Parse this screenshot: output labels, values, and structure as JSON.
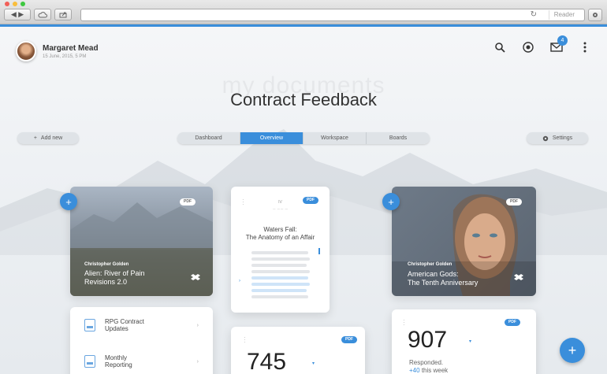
{
  "browser": {
    "reader_label": "Reader"
  },
  "user": {
    "name": "Margaret Mead",
    "date": "15 June, 2015, 5 PM"
  },
  "header": {
    "notification_count": "4"
  },
  "page": {
    "watermark": "my documents",
    "title": "Contract Feedback"
  },
  "toolbar": {
    "add_label": "Add new",
    "settings_label": "Settings"
  },
  "tabs": [
    {
      "label": "Dashboard"
    },
    {
      "label": "Overview",
      "active": true
    },
    {
      "label": "Workspace"
    },
    {
      "label": "Boards"
    }
  ],
  "cards": {
    "alien": {
      "badge": "PDF",
      "author": "Christopher Golden",
      "title": "Alien: River of Pain Revisions 2.0"
    },
    "waters": {
      "badge": "PDF",
      "chapter": "IV",
      "title_line1": "Waters Fall:",
      "title_line2": "The Anatomy of an Affair"
    },
    "american": {
      "badge": "PDF",
      "author": "Christopher Golden",
      "title_line1": "American Gods:",
      "title_line2": "The Tenth Anniversary"
    },
    "list": {
      "items": [
        {
          "line1": "RPG Contract",
          "line2": "Updates"
        },
        {
          "line1": "Monthly",
          "line2": "Reporting"
        }
      ]
    },
    "stat745": {
      "badge": "PDF",
      "value": "745"
    },
    "stat907": {
      "badge": "PDF",
      "value": "907",
      "label": "Responded.",
      "delta": "+40",
      "delta_suffix": "this week"
    }
  },
  "colors": {
    "accent": "#3a8edb",
    "background": "#eef1f4"
  }
}
